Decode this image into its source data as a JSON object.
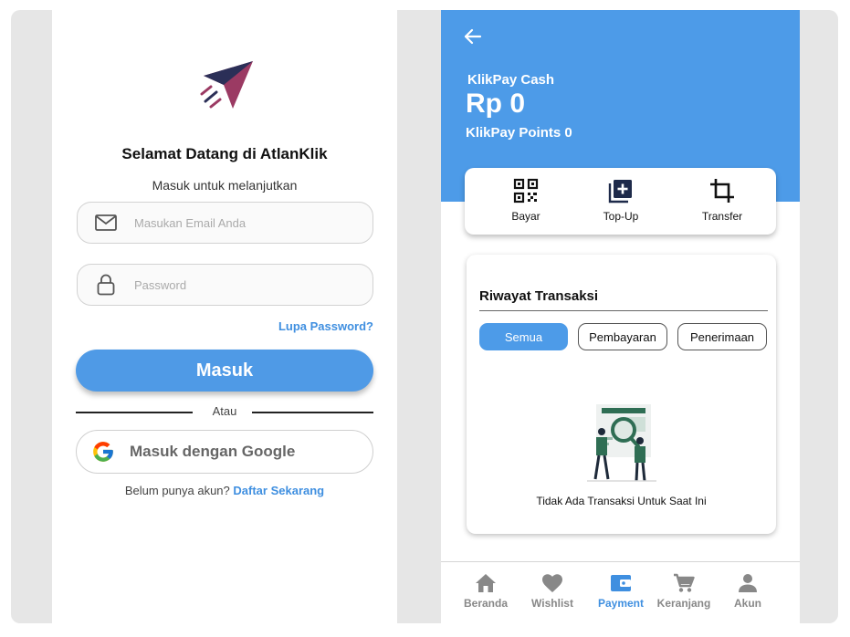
{
  "colors": {
    "primary": "#4d9be8",
    "link": "#3f8fe0",
    "logo_red": "#9b3a63",
    "logo_navy": "#2b2f57",
    "illustration_green": "#2f6e54"
  },
  "login": {
    "logo_icon": "paper-plane-logo",
    "title": "Selamat Datang di AtlanKlik",
    "subtitle": "Masuk untuk melanjutkan",
    "email_placeholder": "Masukan Email Anda",
    "email_icon": "mail-icon",
    "password_placeholder": "Password",
    "password_icon": "lock-icon",
    "forgot_password": "Lupa Password?",
    "submit_label": "Masuk",
    "divider_text": "Atau",
    "google_label": "Masuk dengan Google",
    "google_icon": "google-icon",
    "register_prompt": "Belum punya akun?",
    "register_link": "Daftar Sekarang"
  },
  "wallet": {
    "back_icon": "arrow-left-icon",
    "cash_label": "KlikPay Cash",
    "cash_amount": "Rp 0",
    "points_label": "KlikPay Points 0",
    "actions": [
      {
        "label": "Bayar",
        "icon": "qr-code-icon"
      },
      {
        "label": "Top-Up",
        "icon": "add-box-icon"
      },
      {
        "label": "Transfer",
        "icon": "crop-icon"
      }
    ],
    "history": {
      "title": "Riwayat Transaksi",
      "filters": [
        "Semua",
        "Pembayaran",
        "Penerimaan"
      ],
      "active_filter": "Semua",
      "empty_message": "Tidak Ada Transaksi Untuk Saat Ini"
    },
    "bottom_nav": [
      {
        "label": "Beranda",
        "icon": "home-icon",
        "active": false
      },
      {
        "label": "Wishlist",
        "icon": "heart-icon",
        "active": false
      },
      {
        "label": "Payment",
        "icon": "wallet-icon",
        "active": true
      },
      {
        "label": "Keranjang",
        "icon": "cart-icon",
        "active": false
      },
      {
        "label": "Akun",
        "icon": "person-icon",
        "active": false
      }
    ]
  }
}
